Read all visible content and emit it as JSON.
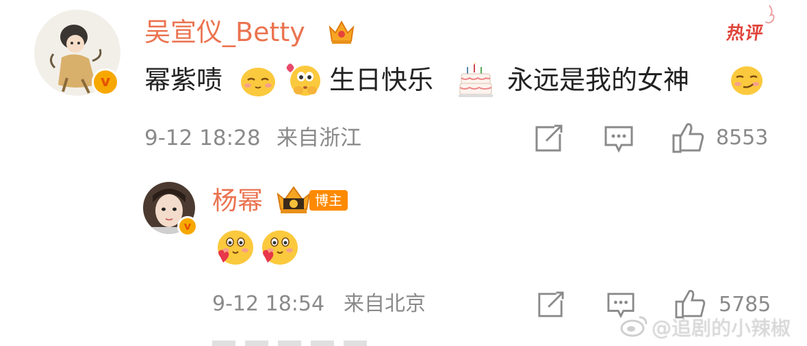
{
  "comment": {
    "username": "吴宣仪_Betty",
    "hot_label": "热评",
    "text_part1": "幂紫啧",
    "text_part2": "生日快乐",
    "text_part3": "永远是我的女神",
    "timestamp": "9-12 18:28",
    "location": "来自浙江",
    "like_count": "8553"
  },
  "reply": {
    "username": "杨幂",
    "badge_label": "博主",
    "timestamp": "9-12 18:54",
    "location": "来自北京",
    "like_count": "5785"
  },
  "watermark": {
    "text": "@追剧的小辣椒"
  },
  "icons": {
    "share": "share-icon",
    "comment": "comment-icon",
    "like": "thumbs-up-icon",
    "verified": "verified-v-icon",
    "crown": "crown-icon",
    "weibo": "weibo-logo-icon"
  },
  "colors": {
    "username": "#eb7350",
    "meta": "#8a8a8a",
    "hot": "#e0443a",
    "verified_badge": "#f7a800"
  }
}
